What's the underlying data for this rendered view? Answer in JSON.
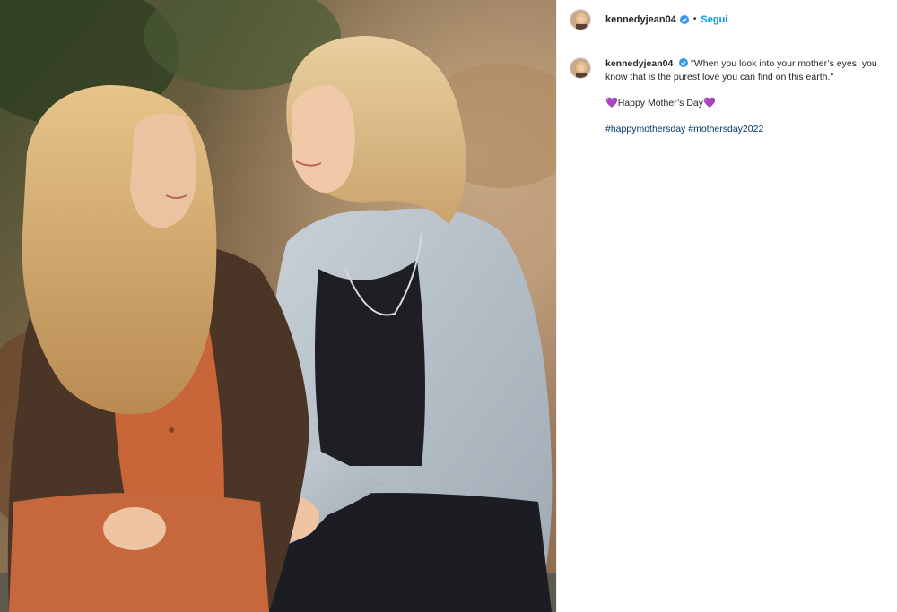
{
  "post": {
    "username": "kennedyjean04",
    "separator": "•",
    "follow_label": "Segui",
    "caption_quote": "\"When you look into your mother’s eyes, you know that is the purest love you can find on this earth.\"",
    "greeting": "Happy Mother’s Day",
    "heart_glyph": "💜",
    "hashtags": [
      "#happymothersday",
      "#mothersday2022"
    ]
  },
  "colors": {
    "link_blue": "#0095f6",
    "hashtag_blue": "#00376b",
    "heart_purple": "#8a4fd8",
    "verified_blue": "#3897f0"
  },
  "icons": {
    "verified": "verified-badge-icon",
    "heart": "purple-heart-icon"
  }
}
